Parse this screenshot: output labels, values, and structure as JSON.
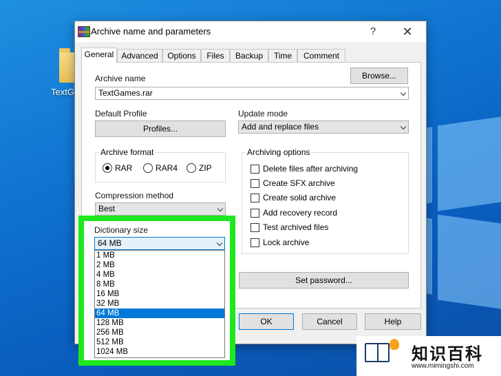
{
  "desktop": {
    "icon_label": "TextG"
  },
  "dialog": {
    "title": "Archive name and parameters",
    "help_glyph": "?",
    "close_glyph": "✕",
    "tabs": [
      {
        "label": "General",
        "active": true
      },
      {
        "label": "Advanced"
      },
      {
        "label": "Options"
      },
      {
        "label": "Files"
      },
      {
        "label": "Backup"
      },
      {
        "label": "Time"
      },
      {
        "label": "Comment"
      }
    ],
    "archive_name_label": "Archive name",
    "browse_label": "Browse...",
    "archive_name_value": "TextGames.rar",
    "default_profile_label": "Default Profile",
    "profiles_label": "Profiles...",
    "update_mode_label": "Update mode",
    "update_mode_value": "Add and replace files",
    "archive_format": {
      "title": "Archive format",
      "options": [
        {
          "label": "RAR",
          "selected": true
        },
        {
          "label": "RAR4",
          "selected": false
        },
        {
          "label": "ZIP",
          "selected": false
        }
      ]
    },
    "archiving_options": {
      "title": "Archiving options",
      "items": [
        {
          "label": "Delete files after archiving",
          "checked": false
        },
        {
          "label": "Create SFX archive",
          "checked": false
        },
        {
          "label": "Create solid archive",
          "checked": false
        },
        {
          "label": "Add recovery record",
          "checked": false
        },
        {
          "label": "Test archived files",
          "checked": false
        },
        {
          "label": "Lock archive",
          "checked": false
        }
      ]
    },
    "compression_method_label": "Compression method",
    "compression_method_value": "Best",
    "dictionary_size_label": "Dictionary size",
    "dictionary_size_value": "64 MB",
    "dictionary_options": [
      "1 MB",
      "2 MB",
      "4 MB",
      "8 MB",
      "16 MB",
      "32 MB",
      "64 MB",
      "128 MB",
      "256 MB",
      "512 MB",
      "1024 MB"
    ],
    "dictionary_selected_index": 6,
    "set_password_label": "Set password...",
    "ok_label": "OK",
    "cancel_label": "Cancel",
    "help_label": "Help"
  },
  "watermark": {
    "title": "知识百科",
    "url": "www.mimingshi.com"
  },
  "colors": {
    "highlight": "#1ee81e",
    "selection": "#0078d7",
    "desktop": "#1074d1"
  }
}
